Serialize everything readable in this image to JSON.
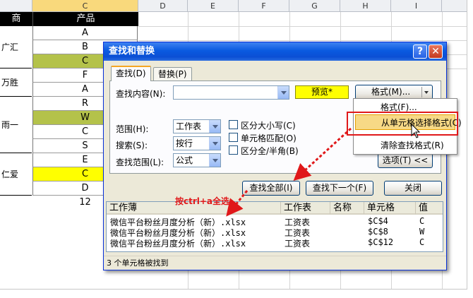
{
  "sheet": {
    "columns": [
      "C",
      "D",
      "E",
      "F",
      "G",
      "H",
      "I"
    ],
    "header_a": "商",
    "header_c": "产品",
    "a_cells": [
      "广汇",
      "万胜",
      "雨一",
      "仁爱"
    ],
    "c_cells": [
      "A",
      "B",
      "C",
      "F",
      "A",
      "R",
      "W",
      "C",
      "S",
      "E",
      "C",
      "D",
      "12"
    ]
  },
  "dialog": {
    "title": "查找和替换",
    "help": "?",
    "close": "✕",
    "tabs": [
      "查找(D)",
      "替换(P)"
    ],
    "find_label": "查找内容(N):",
    "find_value": "",
    "preview": "预览*",
    "format_btn": "格式(M)...",
    "scope_label": "范围(H):",
    "scope_value": "工作表",
    "search_label": "搜索(S):",
    "search_value": "按行",
    "lookin_label": "查找范围(L):",
    "lookin_value": "公式",
    "match_case": "区分大小写(C)",
    "match_cell": "单元格匹配(O)",
    "match_width": "区分全/半角(B)",
    "options_btn": "选项(T) <<",
    "find_all": "查找全部(I)",
    "find_next": "查找下一个(F)",
    "close_btn": "关闭"
  },
  "format_menu": [
    "格式(F)...",
    "从单元格选择格式(C)",
    "清除查找格式(R)"
  ],
  "results": {
    "headers": [
      "工作薄",
      "工作表",
      "名称",
      "单元格",
      "值"
    ],
    "rows": [
      {
        "book": "微信平台粉丝月度分析（新）.xlsx",
        "sheet": "工资表",
        "name": "",
        "cell": "$C$4",
        "value": "C"
      },
      {
        "book": "微信平台粉丝月度分析（新）.xlsx",
        "sheet": "工资表",
        "name": "",
        "cell": "$C$8",
        "value": "W"
      },
      {
        "book": "微信平台粉丝月度分析（新）.xlsx",
        "sheet": "工资表",
        "name": "",
        "cell": "$C$12",
        "value": "C"
      }
    ],
    "status": "3 个单元格被找到"
  },
  "annotation": "按ctrl+a全选",
  "colors": {
    "accent": "#e0181a",
    "highlight_yellow": "#ffff00",
    "highlight_olive": "#b4c24a",
    "titlebar": "#0a5ae0"
  }
}
